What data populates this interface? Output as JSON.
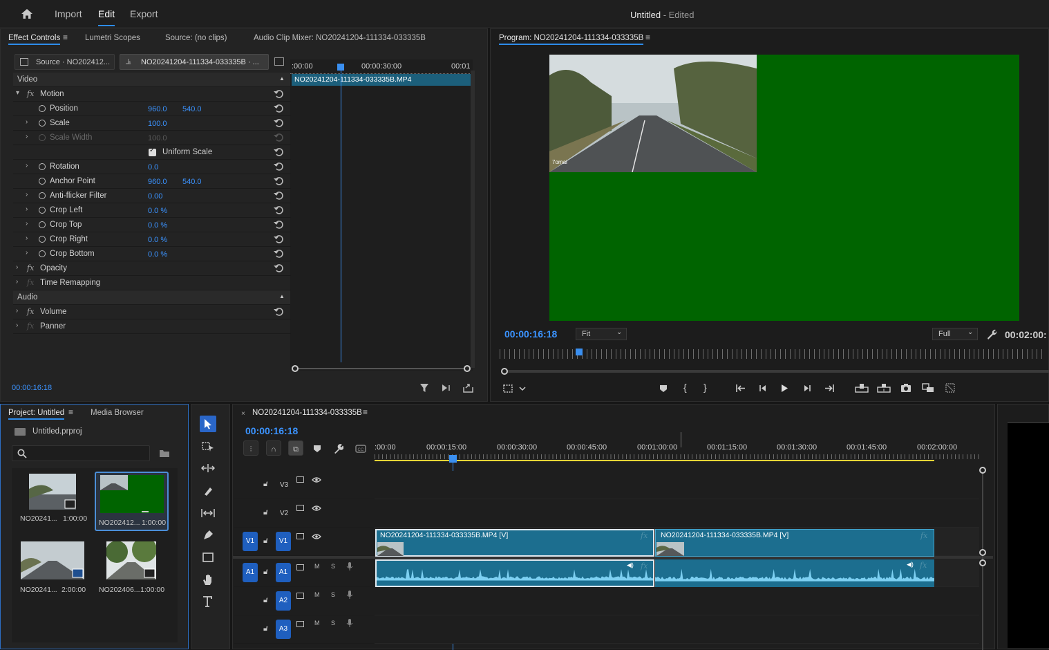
{
  "topbar": {
    "nav": [
      "Import",
      "Edit",
      "Export"
    ],
    "title": "Untitled",
    "title_suffix": " - Edited"
  },
  "effect_controls": {
    "tabs": [
      "Effect Controls",
      "Lumetri Scopes",
      "Source: (no clips)",
      "Audio Clip Mixer: NO20241204-111334-033335B"
    ],
    "source_label": "Source · NO202412...",
    "clip_label": "NO20241204-111334-033335B · ...",
    "mini_ruler": [
      ":00:00",
      "00:00:30:00",
      "00:01"
    ],
    "clip_bar": "NO20241204-111334-033335B.MP4",
    "section_video": "Video",
    "section_audio": "Audio",
    "motion": "Motion",
    "rows": [
      {
        "label": "Position",
        "v1": "960.0",
        "v2": "540.0"
      },
      {
        "label": "Scale",
        "v1": "100.0"
      },
      {
        "label": "Scale Width",
        "v1": "100.0"
      },
      {
        "label": "Uniform Scale"
      },
      {
        "label": "Rotation",
        "v1": "0.0"
      },
      {
        "label": "Anchor Point",
        "v1": "960.0",
        "v2": "540.0"
      },
      {
        "label": "Anti-flicker Filter",
        "v1": "0.00"
      },
      {
        "label": "Crop Left",
        "v1": "0.0 %"
      },
      {
        "label": "Crop Top",
        "v1": "0.0 %"
      },
      {
        "label": "Crop Right",
        "v1": "0.0 %"
      },
      {
        "label": "Crop Bottom",
        "v1": "0.0 %"
      }
    ],
    "opacity": "Opacity",
    "time_remapping": "Time Remapping",
    "volume": "Volume",
    "panner": "Panner",
    "timecode": "00:00:16:18"
  },
  "program": {
    "title": "Program: NO20241204-111334-033335B",
    "timecode": "00:00:16:18",
    "fit": "Fit",
    "quality": "Full",
    "duration": "00:02:00:",
    "video_overlay": "7omai",
    "colors": {
      "green": "#006400",
      "accent": "#2d8ceb"
    }
  },
  "project": {
    "tabs": [
      "Project: Untitled",
      "Media Browser"
    ],
    "file": "Untitled.prproj",
    "items": [
      {
        "name": "NO20241...",
        "dur": "1:00:00"
      },
      {
        "name": "NO202412...",
        "dur": "1:00:00"
      },
      {
        "name": "NO20241...",
        "dur": "2:00:00"
      },
      {
        "name": "NO202406...",
        "dur": "1:00:00"
      }
    ]
  },
  "timeline": {
    "title": "NO20241204-111334-033335B",
    "timecode": "00:00:16:18",
    "ruler": [
      ":00:00",
      "00:00:15:00",
      "00:00:30:00",
      "00:00:45:00",
      "00:01:00:00",
      "00:01:15:00",
      "00:01:30:00",
      "00:01:45:00",
      "00:02:00:00"
    ],
    "tracks": {
      "v3": "V3",
      "v2": "V2",
      "v1": "V1",
      "a1": "A1",
      "a2": "A2",
      "a3": "A3"
    },
    "source_v1": "V1",
    "source_a1": "A1",
    "track_m": "M",
    "track_s": "S",
    "clip1": "NO20241204-111334-033335B.MP4 [V]",
    "clip2": "NO20241204-111334-033335B.MP4 [V]",
    "fx": "fx"
  }
}
